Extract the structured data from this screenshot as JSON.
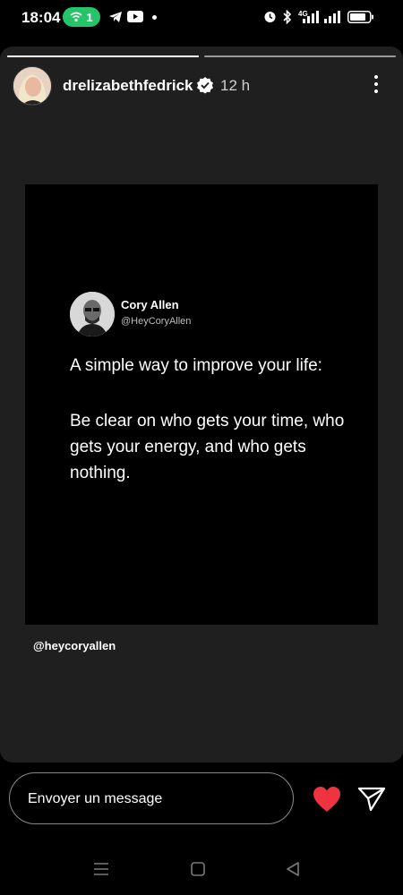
{
  "status_bar": {
    "time": "18:04",
    "hotspot_count": "1",
    "network": "4G",
    "icons": [
      "wifi-hotspot-icon",
      "telegram-icon",
      "youtube-icon",
      "notification-dot-icon",
      "alarm-icon",
      "bluetooth-icon",
      "signal-icon",
      "signal-icon",
      "battery-icon"
    ]
  },
  "story": {
    "progress": [
      1.0,
      0.0
    ],
    "username": "drelizabethfedrick",
    "verified": true,
    "time_ago": "12 h",
    "post": {
      "author_name": "Cory Allen",
      "author_handle": "@HeyCoryAllen",
      "line1": "A simple way to improve your life:",
      "body": "Be clear on who gets your time, who gets your energy, and who gets nothing."
    },
    "mention": "@heycoryallen"
  },
  "reply_bar": {
    "placeholder": "Envoyer un message"
  },
  "colors": {
    "hotspot": "#27c36b",
    "heart": "#ef3340",
    "story_bg": "#1e1f1e"
  }
}
